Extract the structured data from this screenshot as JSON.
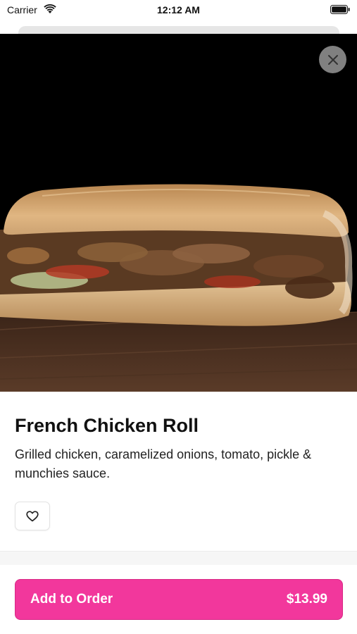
{
  "status_bar": {
    "carrier": "Carrier",
    "time": "12:12 AM"
  },
  "product": {
    "title": "French Chicken Roll",
    "description": "Grilled chicken, caramelized onions, tomato, pickle & munchies sauce."
  },
  "actions": {
    "add_label": "Add to Order",
    "price": "$13.99"
  },
  "icons": {
    "close": "close-icon",
    "favorite": "heart-icon",
    "wifi": "wifi-icon",
    "battery": "battery-icon"
  },
  "colors": {
    "accent": "#f2379c",
    "hero_bg": "#000000"
  }
}
